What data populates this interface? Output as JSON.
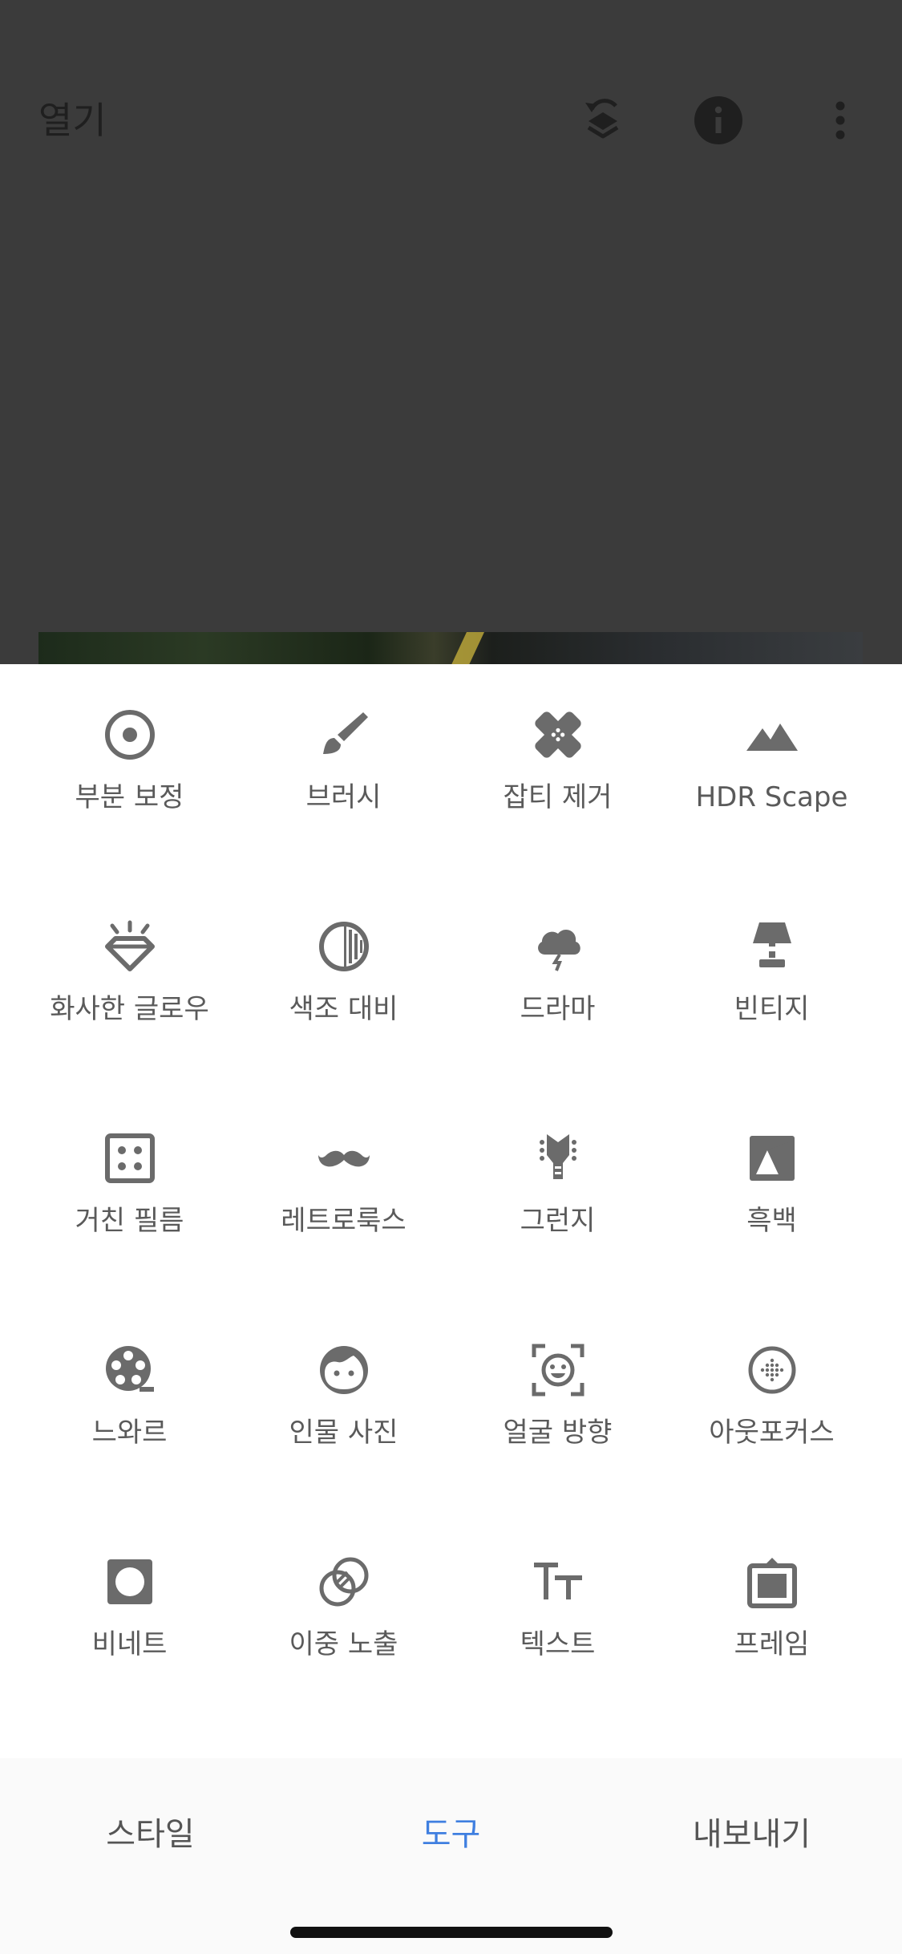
{
  "app_bar": {
    "open_label": "열기",
    "icons": [
      "layers-undo-icon",
      "info-icon",
      "more-vert-icon"
    ]
  },
  "colors": {
    "icon_gray": "#6b6b6b",
    "label_gray": "#5a5a5a",
    "accent_blue": "#3f7fe0",
    "dim_overlay": "#3b3b3b"
  },
  "tools": [
    {
      "label": "부분 보정",
      "icon": "selective-icon"
    },
    {
      "label": "브러시",
      "icon": "brush-icon"
    },
    {
      "label": "잡티 제거",
      "icon": "healing-icon"
    },
    {
      "label": "HDR Scape",
      "icon": "mountains-icon"
    },
    {
      "label": "화사한 글로우",
      "icon": "glamour-glow-icon"
    },
    {
      "label": "색조 대비",
      "icon": "tonal-contrast-icon"
    },
    {
      "label": "드라마",
      "icon": "drama-cloud-icon"
    },
    {
      "label": "빈티지",
      "icon": "vintage-lamp-icon"
    },
    {
      "label": "거친 필름",
      "icon": "grainy-film-icon"
    },
    {
      "label": "레트로룩스",
      "icon": "mustache-icon"
    },
    {
      "label": "그런지",
      "icon": "grunge-guitar-icon"
    },
    {
      "label": "흑백",
      "icon": "black-white-icon"
    },
    {
      "label": "느와르",
      "icon": "film-reel-icon"
    },
    {
      "label": "인물 사진",
      "icon": "portrait-face-icon"
    },
    {
      "label": "얼굴 방향",
      "icon": "head-pose-icon"
    },
    {
      "label": "아웃포커스",
      "icon": "lens-blur-icon"
    },
    {
      "label": "비네트",
      "icon": "vignette-icon"
    },
    {
      "label": "이중 노출",
      "icon": "double-exposure-icon"
    },
    {
      "label": "텍스트",
      "icon": "text-icon"
    },
    {
      "label": "프레임",
      "icon": "frame-icon"
    }
  ],
  "bottom_nav": {
    "styles": "스타일",
    "tools": "도구",
    "export": "내보내기",
    "active": "tools"
  }
}
